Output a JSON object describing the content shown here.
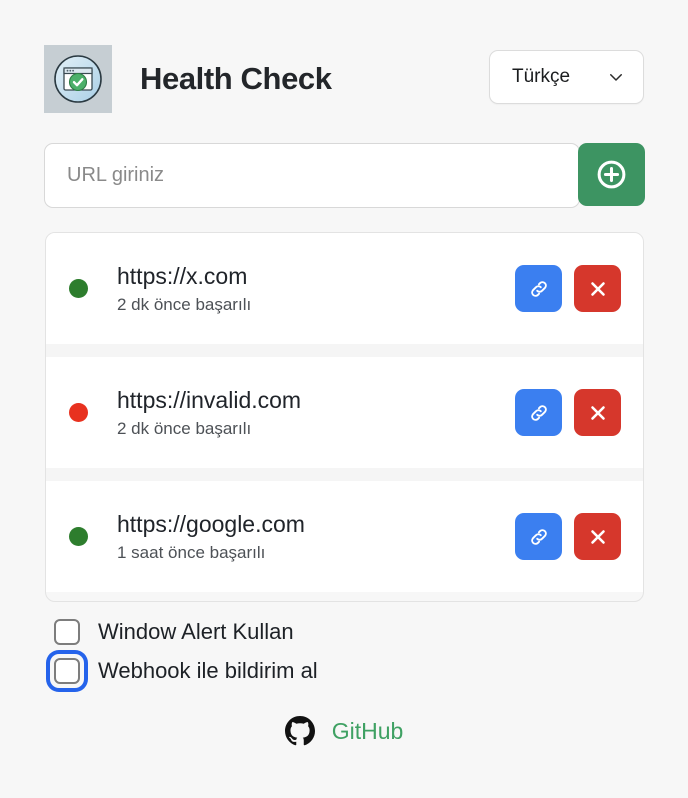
{
  "app": {
    "title": "Health Check",
    "logo_icon": "browser-window-check-icon",
    "background_color": "#f7f7f7"
  },
  "language_selector": {
    "selected": "Türkçe",
    "chevron_icon": "chevron-down-icon",
    "options": [
      "Türkçe"
    ]
  },
  "url_form": {
    "input_value": "",
    "placeholder": "URL giriniz",
    "add_button_icon": "plus-circle-icon",
    "add_button_color": "#3d9462"
  },
  "monitors": [
    {
      "url": "https://x.com",
      "status_text": "2 dk önce başarılı",
      "status": "up",
      "dot_color": "#2d7d2d",
      "link_icon": "chain-link-icon",
      "delete_icon": "close-x-icon"
    },
    {
      "url": "https://invalid.com",
      "status_text": "2 dk önce başarılı",
      "status": "down",
      "dot_color": "#e8311f",
      "link_icon": "chain-link-icon",
      "delete_icon": "close-x-icon"
    },
    {
      "url": "https://google.com",
      "status_text": "1 saat önce başarılı",
      "status": "up",
      "dot_color": "#2d7d2d",
      "link_icon": "chain-link-icon",
      "delete_icon": "close-x-icon"
    }
  ],
  "settings": {
    "window_alert": {
      "label": "Window Alert Kullan",
      "checked": false,
      "focused": false
    },
    "webhook": {
      "label": "Webhook ile bildirim al",
      "checked": false,
      "focused": true
    }
  },
  "footer": {
    "github_label": "GitHub",
    "github_icon": "github-octocat-icon",
    "github_color": "#3fa163"
  }
}
